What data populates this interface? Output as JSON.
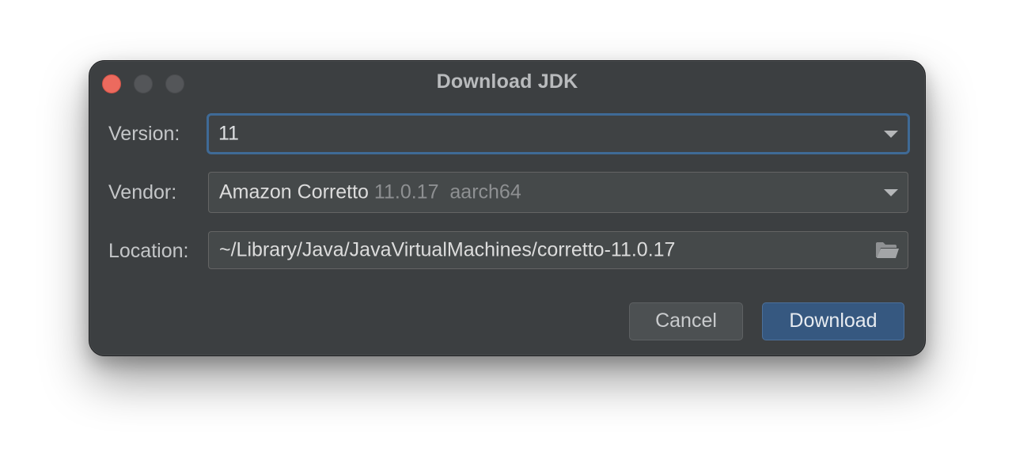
{
  "dialog": {
    "title": "Download JDK",
    "window_controls": [
      "close-icon",
      "minimize-icon",
      "zoom-icon"
    ]
  },
  "form": {
    "version": {
      "label": "Version:",
      "value": "11"
    },
    "vendor": {
      "label": "Vendor:",
      "value": "Amazon Corretto",
      "version_detail": "11.0.17",
      "arch_detail": "aarch64"
    },
    "location": {
      "label": "Location:",
      "value": "~/Library/Java/JavaVirtualMachines/corretto-11.0.17",
      "browse_icon": "folder-icon"
    }
  },
  "buttons": {
    "cancel_label": "Cancel",
    "download_label": "Download"
  },
  "colors": {
    "dialog_bg": "#3c3f41",
    "close_button": "#ec6a5e",
    "focus_ring": "#3f6a96",
    "primary_button": "#365880"
  }
}
